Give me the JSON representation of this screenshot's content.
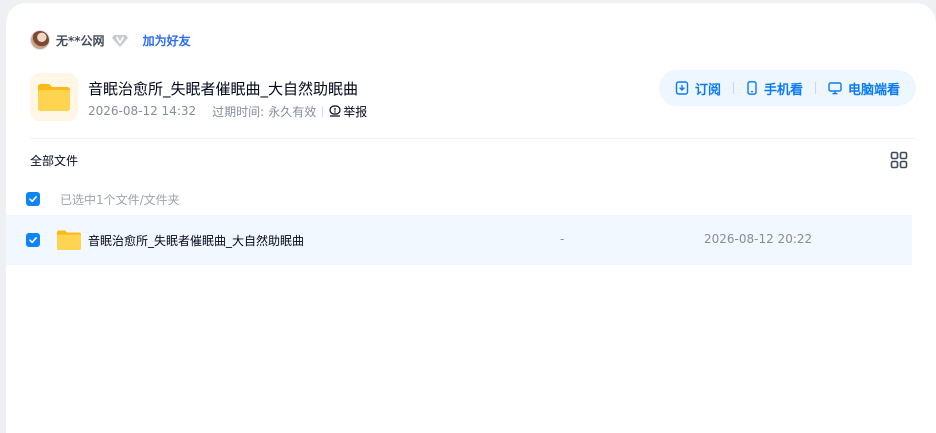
{
  "user": {
    "name": "无**公网",
    "add_friend_label": "加为好友"
  },
  "share": {
    "title": "音眠治愈所_失眠者催眠曲_大自然助眠曲",
    "date": "2026-08-12 14:32",
    "expire_label": "过期时间:",
    "expire_value": "永久有效",
    "report_label": "举报"
  },
  "actions": {
    "subscribe_label": "订阅",
    "mobile_label": "手机看",
    "desktop_label": "电脑端看"
  },
  "files": {
    "section_label": "全部文件",
    "selection_text": "已选中1个文件/文件夹",
    "rows": [
      {
        "name": "音眠治愈所_失眠者催眠曲_大自然助眠曲",
        "size": "-",
        "date": "2026-08-12 20:22"
      }
    ]
  },
  "colors": {
    "accent": "#0d84f7",
    "action_text": "#0b7bf2",
    "selected_row_bg": "#f2f8ff",
    "folder_yellow": "#ffc933"
  },
  "icons": {
    "vip": "diamond-v-icon",
    "report": "alert-icon",
    "subscribe": "subscribe-icon",
    "mobile": "phone-icon",
    "desktop": "monitor-icon",
    "grid": "grid-view-icon",
    "folder": "folder-icon"
  }
}
